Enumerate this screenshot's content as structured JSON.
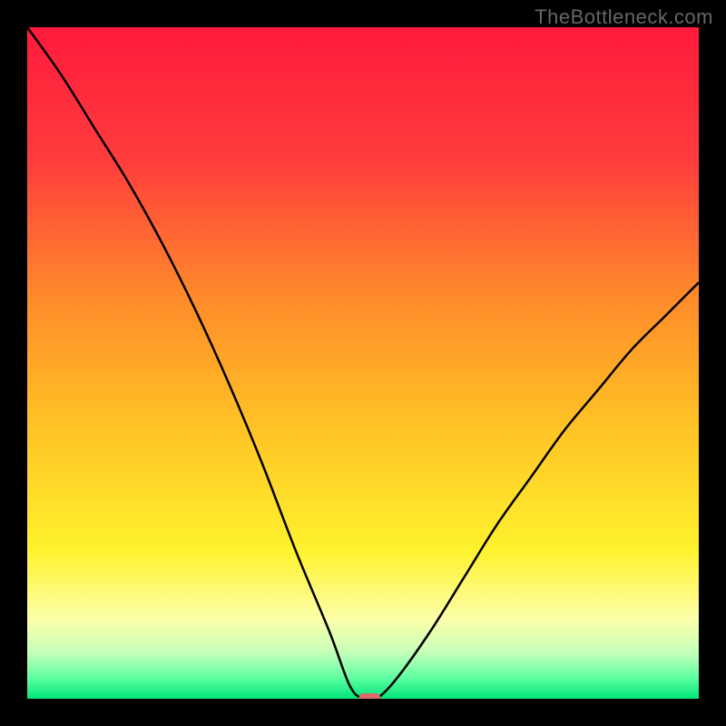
{
  "watermark": "TheBottleneck.com",
  "chart_data": {
    "type": "line",
    "title": "",
    "xlabel": "",
    "ylabel": "",
    "xlim": [
      0,
      100
    ],
    "ylim": [
      0,
      100
    ],
    "x": [
      0,
      5,
      10,
      15,
      20,
      25,
      30,
      35,
      40,
      45,
      48,
      50,
      52,
      55,
      60,
      65,
      70,
      75,
      80,
      85,
      90,
      95,
      100
    ],
    "y": [
      100,
      93,
      85,
      77,
      68,
      58,
      47,
      35,
      22,
      10,
      2,
      0,
      0,
      3,
      10,
      18,
      26,
      33,
      40,
      46,
      52,
      57,
      62
    ],
    "marker": {
      "x": 51,
      "y": 0,
      "color": "#d96a6a"
    },
    "gradient_stops": [
      {
        "offset": 0.0,
        "color": "#ff1a3c"
      },
      {
        "offset": 0.2,
        "color": "#ff3d3d"
      },
      {
        "offset": 0.4,
        "color": "#ff8a2a"
      },
      {
        "offset": 0.6,
        "color": "#ffc425"
      },
      {
        "offset": 0.78,
        "color": "#fff22e"
      },
      {
        "offset": 0.88,
        "color": "#fdffa8"
      },
      {
        "offset": 0.93,
        "color": "#c7ffba"
      },
      {
        "offset": 0.97,
        "color": "#5cffa0"
      },
      {
        "offset": 1.0,
        "color": "#00e37a"
      }
    ]
  }
}
